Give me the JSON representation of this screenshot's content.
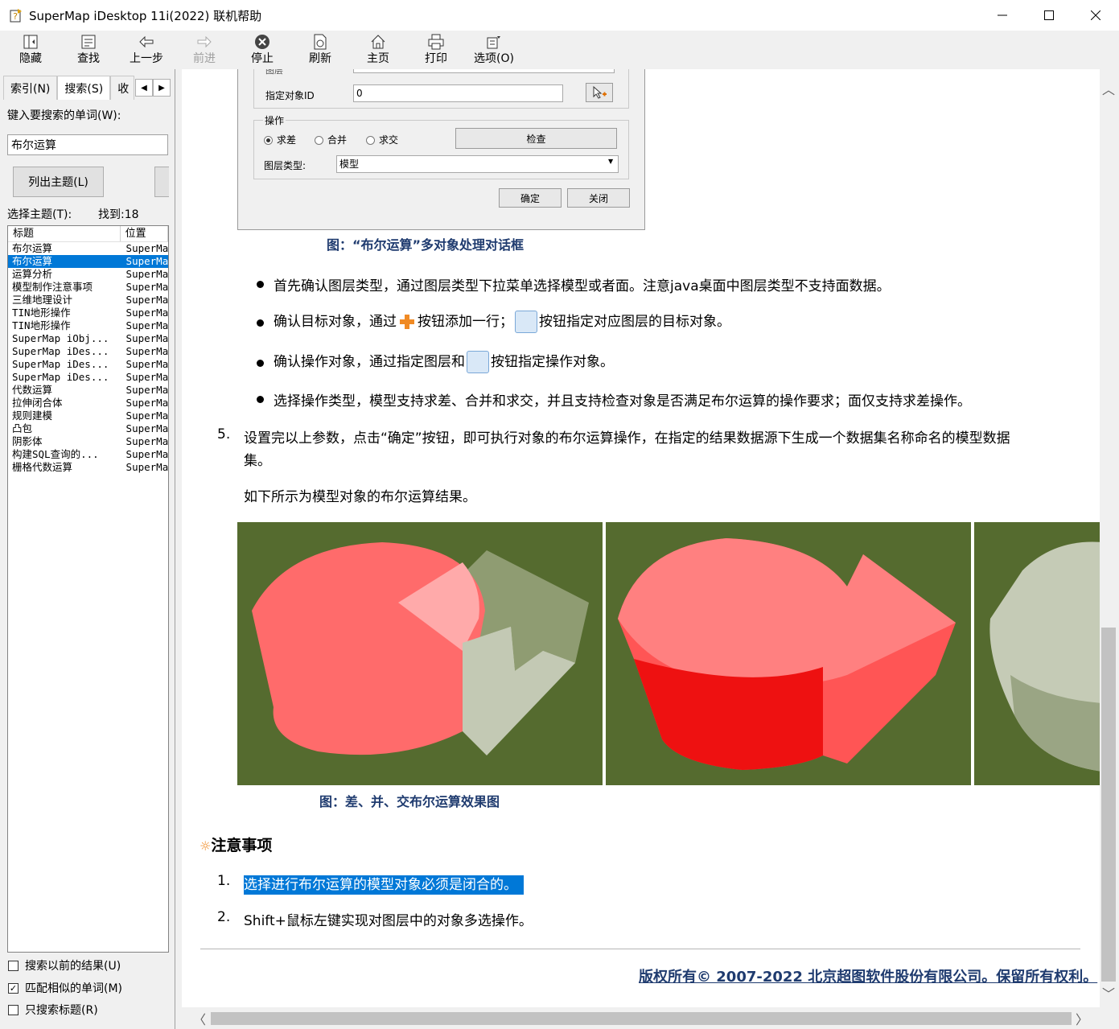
{
  "window": {
    "title": "SuperMap iDesktop 11i(2022) 联机帮助"
  },
  "toolbar": {
    "items": [
      {
        "label": "隐藏",
        "icon": "hide-icon"
      },
      {
        "label": "查找",
        "icon": "locate-icon"
      },
      {
        "label": "上一步",
        "icon": "back-arrow-icon"
      },
      {
        "label": "前进",
        "icon": "forward-arrow-icon"
      },
      {
        "label": "停止",
        "icon": "stop-icon"
      },
      {
        "label": "刷新",
        "icon": "refresh-icon"
      },
      {
        "label": "主页",
        "icon": "home-icon"
      },
      {
        "label": "打印",
        "icon": "print-icon"
      },
      {
        "label": "选项(O)",
        "icon": "options-icon"
      }
    ]
  },
  "left": {
    "tabs": [
      "索引(N)",
      "搜索(S)",
      "收"
    ],
    "search_label": "键入要搜索的单词(W):",
    "search_value": "布尔运算",
    "list_button": "列出主题(L)",
    "select_label": "选择主题(T):",
    "found_label": "找到:18",
    "columns": [
      "标题",
      "位置"
    ],
    "results": [
      {
        "title": "布尔运算",
        "loc": "SuperMa"
      },
      {
        "title": "布尔运算",
        "loc": "SuperMa"
      },
      {
        "title": "运算分析",
        "loc": "SuperMa"
      },
      {
        "title": "模型制作注意事项",
        "loc": "SuperMa"
      },
      {
        "title": "三维地理设计",
        "loc": "SuperMa"
      },
      {
        "title": "TIN地形操作",
        "loc": "SuperMa"
      },
      {
        "title": "TIN地形操作",
        "loc": "SuperMa"
      },
      {
        "title": "SuperMap iObj...",
        "loc": "SuperMa"
      },
      {
        "title": "SuperMap iDes...",
        "loc": "SuperMa"
      },
      {
        "title": "SuperMap iDes...",
        "loc": "SuperMa"
      },
      {
        "title": "SuperMap iDes...",
        "loc": "SuperMa"
      },
      {
        "title": "代数运算",
        "loc": "SuperMa"
      },
      {
        "title": "拉伸闭合体",
        "loc": "SuperMa"
      },
      {
        "title": "规则建模",
        "loc": "SuperMa"
      },
      {
        "title": "凸包",
        "loc": "SuperMa"
      },
      {
        "title": "阴影体",
        "loc": "SuperMa"
      },
      {
        "title": "构建SQL查询的...",
        "loc": "SuperMa"
      },
      {
        "title": "栅格代数运算",
        "loc": "SuperMa"
      }
    ],
    "selected_index": 1,
    "options": [
      {
        "label": "搜索以前的结果(U)",
        "checked": false
      },
      {
        "label": "匹配相似的单词(M)",
        "checked": true
      },
      {
        "label": "只搜索标题(R)",
        "checked": false
      }
    ]
  },
  "dialog": {
    "layer_label_partial": "图层",
    "object_id_label": "指定对象ID",
    "object_id_value": "0",
    "group_label": "操作",
    "radios": [
      {
        "label": "求差",
        "checked": true
      },
      {
        "label": "合并",
        "checked": false
      },
      {
        "label": "求交",
        "checked": false
      }
    ],
    "check_button": "检查",
    "layer_type_label": "图层类型:",
    "layer_type_value": "模型",
    "ok_button": "确定",
    "close_button": "关闭"
  },
  "content": {
    "dialog_caption": "图：“布尔运算”多对象处理对话框",
    "bullets": {
      "b1": "首先确认图层类型，通过图层类型下拉菜单选择模型或者面。注意java桌面中图层类型不支持面数据。",
      "b2a": "确认目标对象，通过",
      "b2b": "按钮添加一行；",
      "b2c": "按钮指定对应图层的目标对象。",
      "b3a": "确认操作对象，通过指定图层和",
      "b3b": "按钮指定操作对象。",
      "b4": "选择操作类型，模型支持求差、合并和求交，并且支持检查对象是否满足布尔运算的操作要求；面仅支持求差操作。"
    },
    "step5_num": "5.",
    "step5_line1": "设置完以上参数，点击“确定”按钮，即可执行对象的布尔运算操作，在指定的结果数据源下生成一个数据集名称命名的模型数据",
    "step5_line2": "集。",
    "result_intro": "如下所示为模型对象的布尔运算结果。",
    "image_caption": "图：差、并、交布尔运算效果图",
    "notes_title": "注意事项",
    "notes": [
      {
        "num": "1.",
        "text": "选择进行布尔运算的模型对象必须是闭合的。"
      },
      {
        "num": "2.",
        "text": "Shift+鼠标左键实现对图层中的对象多选操作。"
      }
    ],
    "copyright": "版权所有© 2007-2022 北京超图软件股份有限公司。保留所有权利。"
  },
  "colors": {
    "selection": "#0078d7",
    "caption": "#1f3b6f",
    "olive_bg": "#556b2f",
    "model_red": "#ff6b6b",
    "model_grey": "#b8c2a8"
  }
}
